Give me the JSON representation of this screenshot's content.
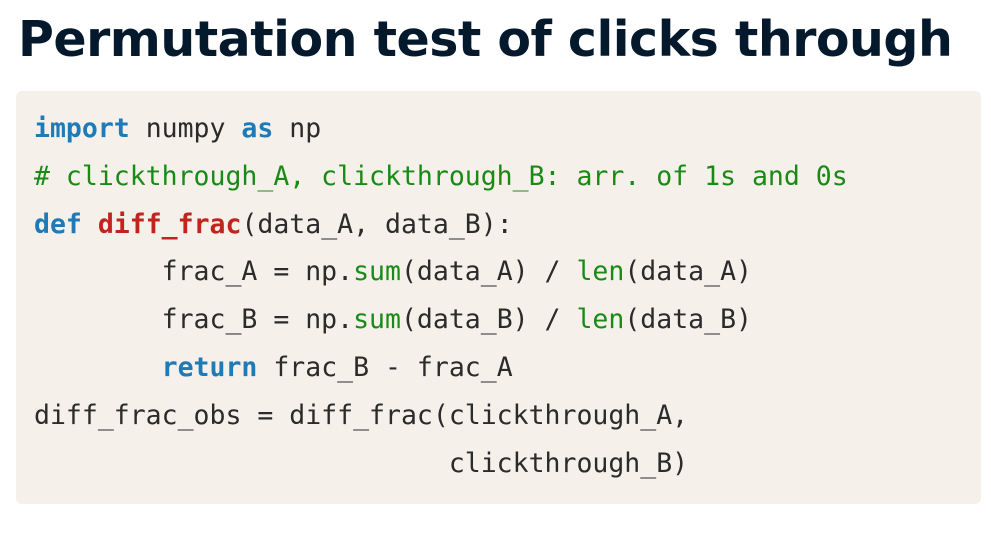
{
  "title": "Permutation test of clicks through",
  "code": {
    "line1": {
      "kw_import": "import",
      "t1": " numpy ",
      "kw_as": "as",
      "t2": " np"
    },
    "line2": {
      "comment": "# clickthrough_A, clickthrough_B: arr. of 1s and 0s"
    },
    "line3": {
      "kw_def": "def",
      "t1": " ",
      "fn_name": "diff_frac",
      "t2": "(data_A, data_B):"
    },
    "line4": {
      "indent": "        ",
      "t1": "frac_A = np.",
      "bi_sum": "sum",
      "t2": "(data_A) / ",
      "bi_len": "len",
      "t3": "(data_A)"
    },
    "line5": {
      "indent": "        ",
      "t1": "frac_B = np.",
      "bi_sum": "sum",
      "t2": "(data_B) / ",
      "bi_len": "len",
      "t3": "(data_B)"
    },
    "line6": {
      "indent": "        ",
      "kw_return": "return",
      "t1": " frac_B - frac_A"
    },
    "line7": {
      "t1": "diff_frac_obs = diff_frac(clickthrough_A,"
    },
    "line8": {
      "t1": "                          clickthrough_B)"
    }
  }
}
